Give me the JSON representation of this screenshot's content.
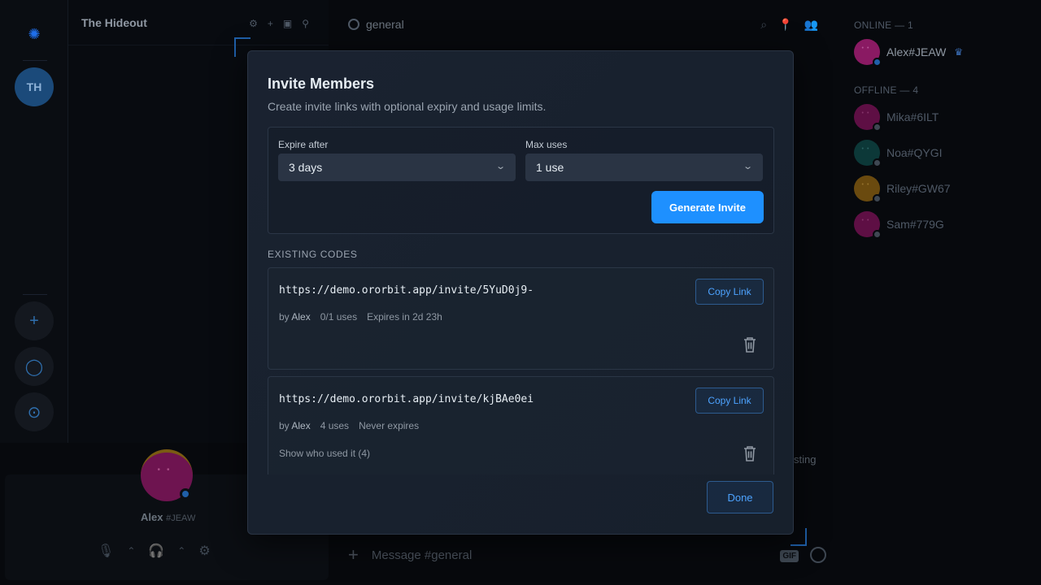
{
  "server": {
    "name": "The Hideout",
    "initials": "TH"
  },
  "channel": {
    "name": "general",
    "message_placeholder": "Message #general",
    "partial_text": "sting",
    "gif_label": "GIF"
  },
  "user": {
    "name": "Alex",
    "tag": "#JEAW"
  },
  "members": {
    "online_header": "ONLINE — 1",
    "offline_header": "OFFLINE — 4",
    "online": [
      {
        "name": "Alex#JEAW",
        "color": "#8a1a63"
      }
    ],
    "offline": [
      {
        "name": "Mika#6ILT",
        "color": "#7a1055"
      },
      {
        "name": "Noa#QYGI",
        "color": "#0f4a4a"
      },
      {
        "name": "Riley#GW67",
        "color": "#7a5812"
      },
      {
        "name": "Sam#779G",
        "color": "#7a1055"
      }
    ]
  },
  "modal": {
    "title": "Invite Members",
    "subtitle": "Create invite links with optional expiry and usage limits.",
    "expire_label": "Expire after",
    "expire_value": "3 days",
    "max_uses_label": "Max uses",
    "max_uses_value": "1 use",
    "generate_label": "Generate Invite",
    "existing_header": "EXISTING CODES",
    "codes": [
      {
        "url": "https://demo.ororbit.app/invite/5YuD0j9-",
        "by_prefix": "by",
        "by_name": "Alex",
        "uses": "0/1 uses",
        "expiry": "Expires in 2d 23h",
        "copy_label": "Copy Link",
        "who_used": ""
      },
      {
        "url": "https://demo.ororbit.app/invite/kjBAe0ei",
        "by_prefix": "by",
        "by_name": "Alex",
        "uses": "4 uses",
        "expiry": "Never expires",
        "copy_label": "Copy Link",
        "who_used": "Show who used it (4)"
      }
    ],
    "done_label": "Done"
  },
  "colors": {
    "accent": "#1e90ff",
    "link": "#4da3ff",
    "modal_bg": "#1a2230"
  }
}
